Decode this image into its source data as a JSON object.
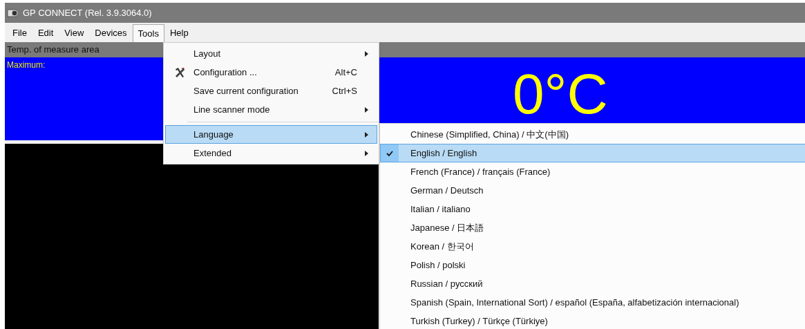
{
  "window": {
    "title": "GP CONNECT (Rel. 3.9.3064.0)"
  },
  "menu_bar": [
    {
      "label": "File",
      "selected": false
    },
    {
      "label": "Edit",
      "selected": false
    },
    {
      "label": "View",
      "selected": false
    },
    {
      "label": "Devices",
      "selected": false
    },
    {
      "label": "Tools",
      "selected": true
    },
    {
      "label": "Help",
      "selected": false
    }
  ],
  "panel": {
    "header": "Temp. of measure area",
    "maximum_label": "Maximum:",
    "reading": "0°C"
  },
  "tools_menu": [
    {
      "kind": "item",
      "label": "Layout",
      "submenu": true,
      "selected": false
    },
    {
      "kind": "item",
      "label": "Configuration ...",
      "shortcut": "Alt+C",
      "submenu": false,
      "selected": false
    },
    {
      "kind": "item",
      "label": "Save current configuration",
      "shortcut": "Ctrl+S",
      "submenu": false,
      "selected": false
    },
    {
      "kind": "item",
      "label": "Line scanner mode",
      "submenu": true,
      "selected": false
    },
    {
      "kind": "separator"
    },
    {
      "kind": "item",
      "label": "Language",
      "submenu": true,
      "selected": true
    },
    {
      "kind": "item",
      "label": "Extended",
      "submenu": true,
      "selected": false
    }
  ],
  "language_menu": [
    {
      "label": "Chinese (Simplified, China) / 中文(中国)",
      "checked": false,
      "selected": false
    },
    {
      "label": "English / English",
      "checked": true,
      "selected": true
    },
    {
      "label": "French (France) / français (France)",
      "checked": false,
      "selected": false
    },
    {
      "label": "German / Deutsch",
      "checked": false,
      "selected": false
    },
    {
      "label": "Italian / italiano",
      "checked": false,
      "selected": false
    },
    {
      "label": "Japanese / 日本語",
      "checked": false,
      "selected": false
    },
    {
      "label": "Korean / 한국어",
      "checked": false,
      "selected": false
    },
    {
      "label": "Polish / polski",
      "checked": false,
      "selected": false
    },
    {
      "label": "Russian / русский",
      "checked": false,
      "selected": false
    },
    {
      "label": "Spanish (Spain, International Sort) / español (España, alfabetización internacional)",
      "checked": false,
      "selected": false
    },
    {
      "label": "Turkish (Turkey) / Türkçe (Türkiye)",
      "checked": false,
      "selected": false
    }
  ]
}
